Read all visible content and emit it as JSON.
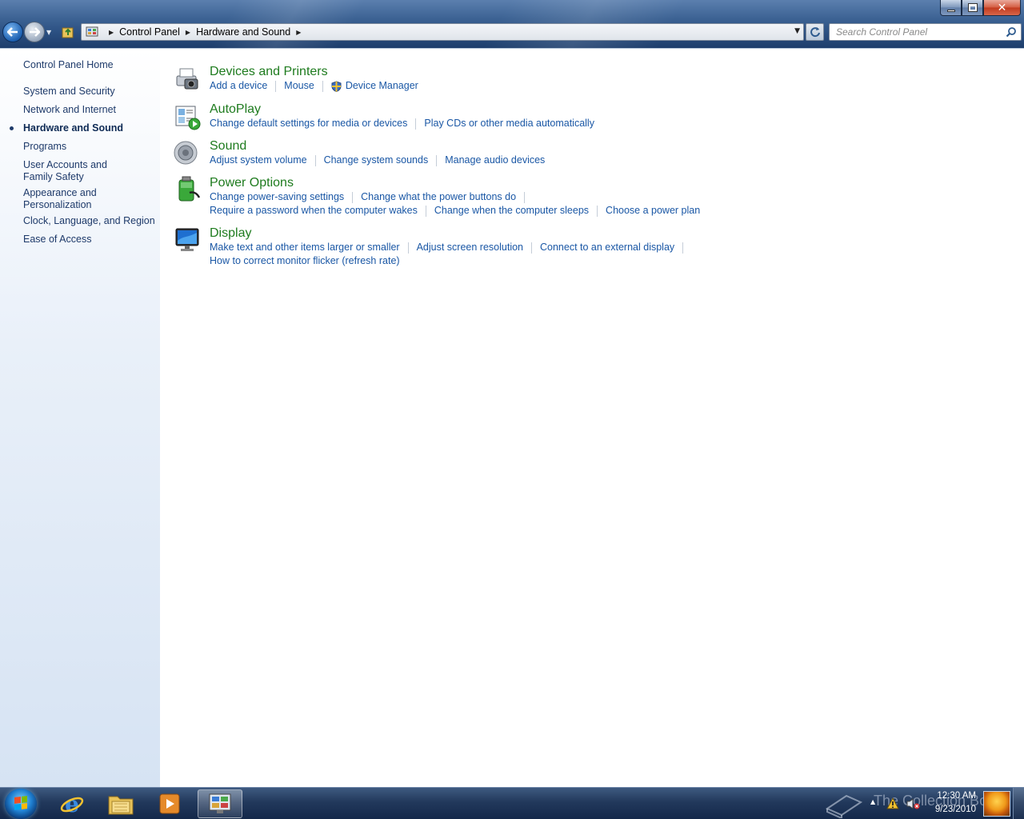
{
  "window": {
    "minimize": "minimize",
    "maximize": "restore",
    "close": "✕"
  },
  "nav": {
    "back": "back",
    "forward": "forward",
    "breadcrumbs": [
      "Control Panel",
      "Hardware and Sound"
    ]
  },
  "search": {
    "placeholder": "Search Control Panel"
  },
  "sidebar": {
    "home": "Control Panel Home",
    "items": [
      {
        "label": "System and Security",
        "active": false
      },
      {
        "label": "Network and Internet",
        "active": false
      },
      {
        "label": "Hardware and Sound",
        "active": true
      },
      {
        "label": "Programs",
        "active": false
      },
      {
        "label": "User Accounts and Family Safety",
        "active": false
      },
      {
        "label": "Appearance and Personalization",
        "active": false
      },
      {
        "label": "Clock, Language, and Region",
        "active": false
      },
      {
        "label": "Ease of Access",
        "active": false
      }
    ]
  },
  "categories": [
    {
      "title": "Devices and Printers",
      "icon": "printer-camera-icon",
      "rows": [
        [
          "Add a device",
          "Mouse",
          "Device Manager"
        ]
      ]
    },
    {
      "title": "AutoPlay",
      "icon": "autoplay-icon",
      "rows": [
        [
          "Change default settings for media or devices",
          "Play CDs or other media automatically"
        ]
      ]
    },
    {
      "title": "Sound",
      "icon": "speaker-icon",
      "rows": [
        [
          "Adjust system volume",
          "Change system sounds",
          "Manage audio devices"
        ]
      ]
    },
    {
      "title": "Power Options",
      "icon": "battery-icon",
      "rows": [
        [
          "Change power-saving settings",
          "Change what the power buttons do"
        ],
        [
          "Require a password when the computer wakes",
          "Change when the computer sleeps",
          "Choose a power plan"
        ]
      ]
    },
    {
      "title": "Display",
      "icon": "monitor-icon",
      "rows": [
        [
          "Make text and other items larger or smaller",
          "Adjust screen resolution",
          "Connect to an external display"
        ],
        [
          "How to correct monitor flicker (refresh rate)"
        ]
      ]
    }
  ],
  "taskbar": {
    "watermark": "The Collection Book",
    "time": "12:30 AM",
    "date": "9/23/2010"
  },
  "colors": {
    "link": "#1a57a5",
    "category_title": "#1e7b1e",
    "sidebar_text": "#1e3a6a"
  }
}
